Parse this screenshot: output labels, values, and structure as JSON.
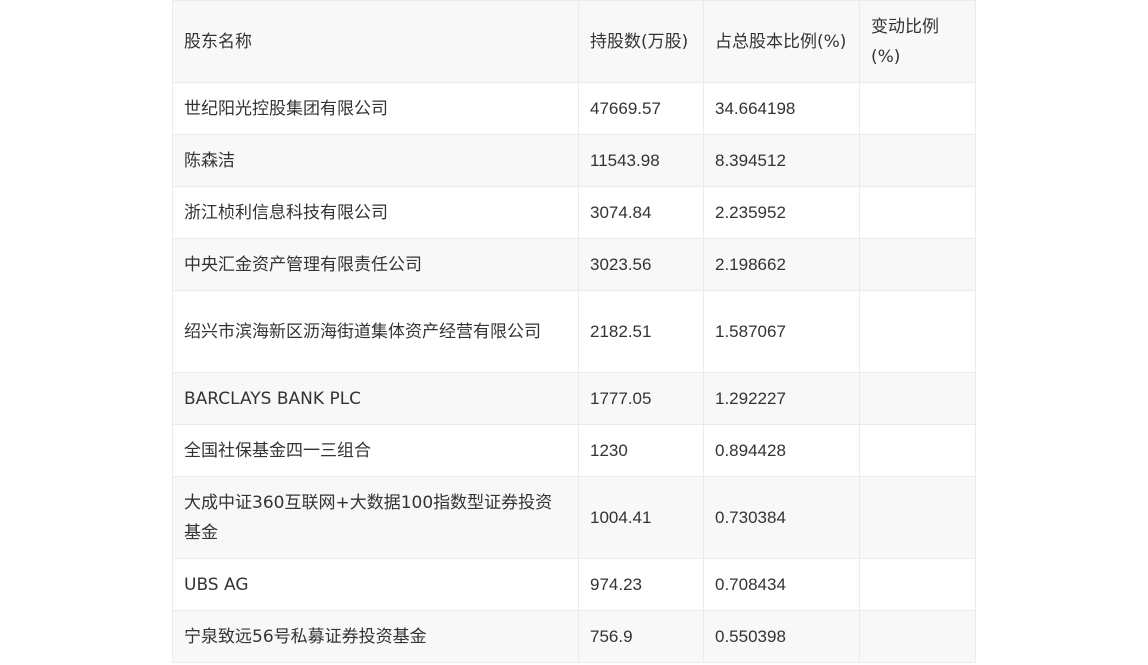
{
  "table": {
    "headers": [
      "股东名称",
      "持股数(万股)",
      "占总股本比例(%)",
      "变动比例(%)"
    ],
    "rows": [
      {
        "name": "世纪阳光控股集团有限公司",
        "shares": "47669.57",
        "ratio": "34.664198",
        "change": ""
      },
      {
        "name": "陈森洁",
        "shares": "11543.98",
        "ratio": "8.394512",
        "change": ""
      },
      {
        "name": "浙江桢利信息科技有限公司",
        "shares": "3074.84",
        "ratio": "2.235952",
        "change": ""
      },
      {
        "name": "中央汇金资产管理有限责任公司",
        "shares": "3023.56",
        "ratio": "2.198662",
        "change": ""
      },
      {
        "name": "绍兴市滨海新区沥海街道集体资产经营有限公司",
        "shares": "2182.51",
        "ratio": "1.587067",
        "change": ""
      },
      {
        "name": "BARCLAYS BANK PLC",
        "shares": "1777.05",
        "ratio": "1.292227",
        "change": ""
      },
      {
        "name": "全国社保基金四一三组合",
        "shares": "1230",
        "ratio": "0.894428",
        "change": ""
      },
      {
        "name": "大成中证360互联网+大数据100指数型证券投资基金",
        "shares": "1004.41",
        "ratio": "0.730384",
        "change": ""
      },
      {
        "name": "UBS AG",
        "shares": "974.23",
        "ratio": "0.708434",
        "change": ""
      },
      {
        "name": "宁泉致远56号私募证券投资基金",
        "shares": "756.9",
        "ratio": "0.550398",
        "change": ""
      }
    ]
  }
}
